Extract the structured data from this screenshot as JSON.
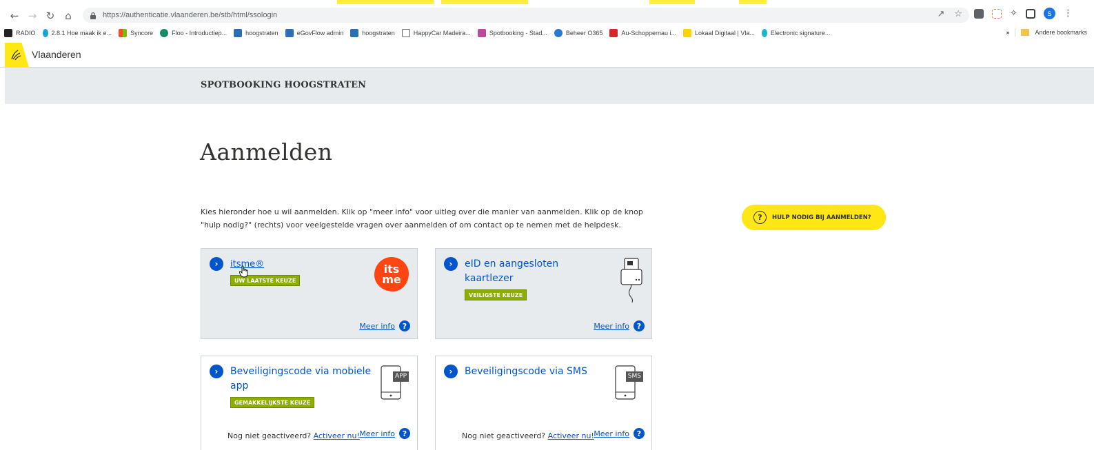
{
  "browser": {
    "url_host": "https://authenticatie.vlaanderen.be",
    "url_path": "/stb/html/ssologin",
    "bookmarks": [
      {
        "label": "RADIO",
        "color": "#222222"
      },
      {
        "label": "2.8.1 Hoe maak ik e...",
        "color": "#1aa3d9"
      },
      {
        "label": "Syncore",
        "color": "#f25022"
      },
      {
        "label": "Floo - Introductiep...",
        "color": "#1b8a6b"
      },
      {
        "label": "hoogstraten",
        "color": "#2c6fb7"
      },
      {
        "label": "eGovFlow admin",
        "color": "#2c6fb7"
      },
      {
        "label": "hoogstraten",
        "color": "#2c6fb7"
      },
      {
        "label": "HappyCar Madeira...",
        "color": "#666666"
      },
      {
        "label": "Spotbooking - Stad...",
        "color": "#c0489a"
      },
      {
        "label": "Beheer O365",
        "color": "#2a7ad0"
      },
      {
        "label": "Au-Schoppernau i...",
        "color": "#d7262b"
      },
      {
        "label": "Lokaal Digitaal | Vla...",
        "color": "#ffd200"
      },
      {
        "label": "Electronic signature...",
        "color": "#19b5c9"
      }
    ],
    "bookmarks_more": "»",
    "other_bookmarks": "Andere bookmarks",
    "profile_initial": "S"
  },
  "header": {
    "brand": "Vlaanderen",
    "site_title": "SPOTBOOKING HOOGSTRATEN"
  },
  "main": {
    "heading": "Aanmelden",
    "intro": "Kies hieronder hoe u wil aanmelden. Klik op \"meer info\" voor uitleg over die manier van aanmelden. Klik op de knop \"hulp nodig?\" (rechts) voor veelgestelde vragen over aanmelden of om contact op te nemen met de helpdesk.",
    "help_button": "HULP NODIG BIJ AANMELDEN?",
    "options": [
      {
        "title": "itsme®",
        "badge": "UW LAATSTE KEUZE",
        "more": "Meer info",
        "logo_top": "its",
        "logo_bottom": "me"
      },
      {
        "title": "eID en aangesloten kaartlezer",
        "badge": "VEILIGSTE KEUZE",
        "more": "Meer info"
      },
      {
        "title": "Beveiligingscode via mobiele app",
        "badge": "GEMAKKELIJKSTE KEUZE",
        "more": "Meer info",
        "not_active": "Nog niet geactiveerd?",
        "activate": "Activeer nu!",
        "icon_label": "APP"
      },
      {
        "title": "Beveiligingscode via SMS",
        "more": "Meer info",
        "not_active": "Nog niet geactiveerd?",
        "activate": "Activeer nu!",
        "icon_label": "SMS"
      }
    ]
  },
  "colors": {
    "accent_yellow": "#ffe615",
    "link_blue": "#0055cc",
    "badge_green": "#8bae00",
    "band_grey": "#e8ebee"
  }
}
